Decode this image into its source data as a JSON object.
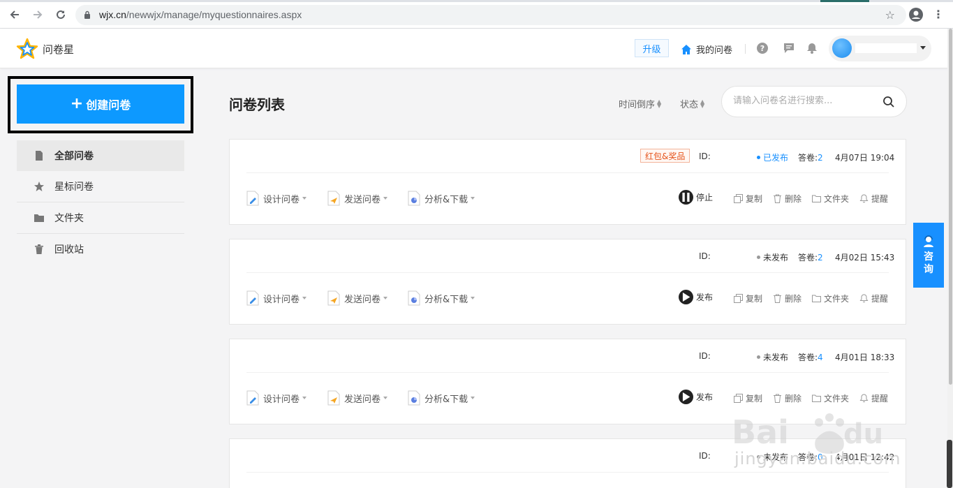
{
  "browser": {
    "url_host": "wjx.cn",
    "url_path": "/newwjx/manage/myquestionnaires.aspx"
  },
  "header": {
    "logo_text": "问卷星",
    "upgrade_label": "升级",
    "my_questionnaires_label": "我的问卷"
  },
  "sidebar": {
    "create_label": "创建问卷",
    "items": [
      {
        "label": "全部问卷",
        "icon": "document-icon"
      },
      {
        "label": "星标问卷",
        "icon": "star-icon"
      },
      {
        "label": "文件夹",
        "icon": "folder-icon"
      },
      {
        "label": "回收站",
        "icon": "trash-icon"
      }
    ]
  },
  "main": {
    "title": "问卷列表",
    "sort_time": "时间倒序",
    "sort_status": "状态",
    "search_placeholder": "请输入问卷名进行搜索...",
    "actions": {
      "design": "设计问卷",
      "send": "发送问卷",
      "analyze": "分析&下载",
      "copy": "复制",
      "delete": "删除",
      "folder": "文件夹",
      "remind": "提醒"
    },
    "cards": [
      {
        "badge": "红包&奖品",
        "id_label": "ID:",
        "status": "已发布",
        "status_color": "#1890ff",
        "answers_label": "答卷:",
        "answers": "2",
        "date": "4月07日 19:04",
        "primary_action": "停止"
      },
      {
        "badge": "",
        "id_label": "ID:",
        "status": "未发布",
        "status_color": "#999999",
        "answers_label": "答卷:",
        "answers": "2",
        "date": "4月02日 15:43",
        "primary_action": "发布"
      },
      {
        "badge": "",
        "id_label": "ID:",
        "status": "未发布",
        "status_color": "#999999",
        "answers_label": "答卷:",
        "answers": "4",
        "date": "4月01日 18:33",
        "primary_action": "发布"
      },
      {
        "badge": "",
        "id_label": "ID:",
        "status": "未发布",
        "status_color": "#999999",
        "answers_label": "答卷:",
        "answers": "0",
        "date": "4月01日 12:42",
        "primary_action": "发布"
      }
    ]
  },
  "consult": {
    "label_1": "咨",
    "label_2": "询"
  },
  "watermark": {
    "text": "jingyan.baidu.com"
  },
  "colors": {
    "primary": "#0d99ff",
    "badge": "#e5531a"
  }
}
